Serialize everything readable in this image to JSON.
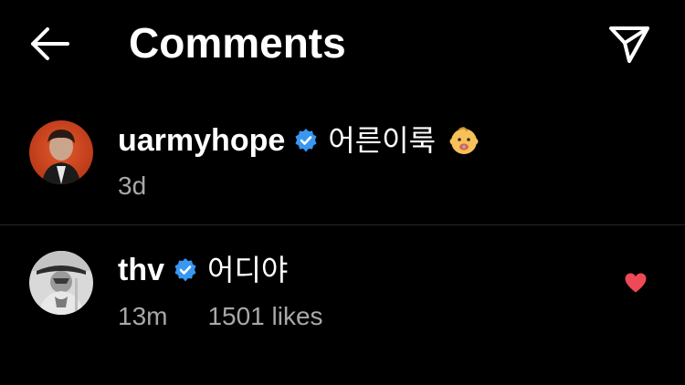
{
  "header": {
    "title": "Comments",
    "back_icon": "arrow-left-icon",
    "share_icon": "paper-plane-icon"
  },
  "colors": {
    "background": "#000000",
    "text_primary": "#ffffff",
    "text_secondary": "#a8a8a8",
    "verified_blue": "#3897f0",
    "like_red": "#ed4956",
    "divider": "#262626"
  },
  "comments": [
    {
      "username": "uarmyhope",
      "verified": true,
      "text": "어른이룩",
      "emoji": "baby-face-emoji",
      "time": "3d",
      "likes": ""
    },
    {
      "username": "thv",
      "verified": true,
      "text": "어디야",
      "time": "13m",
      "likes": "1501 likes",
      "liked": true
    }
  ]
}
